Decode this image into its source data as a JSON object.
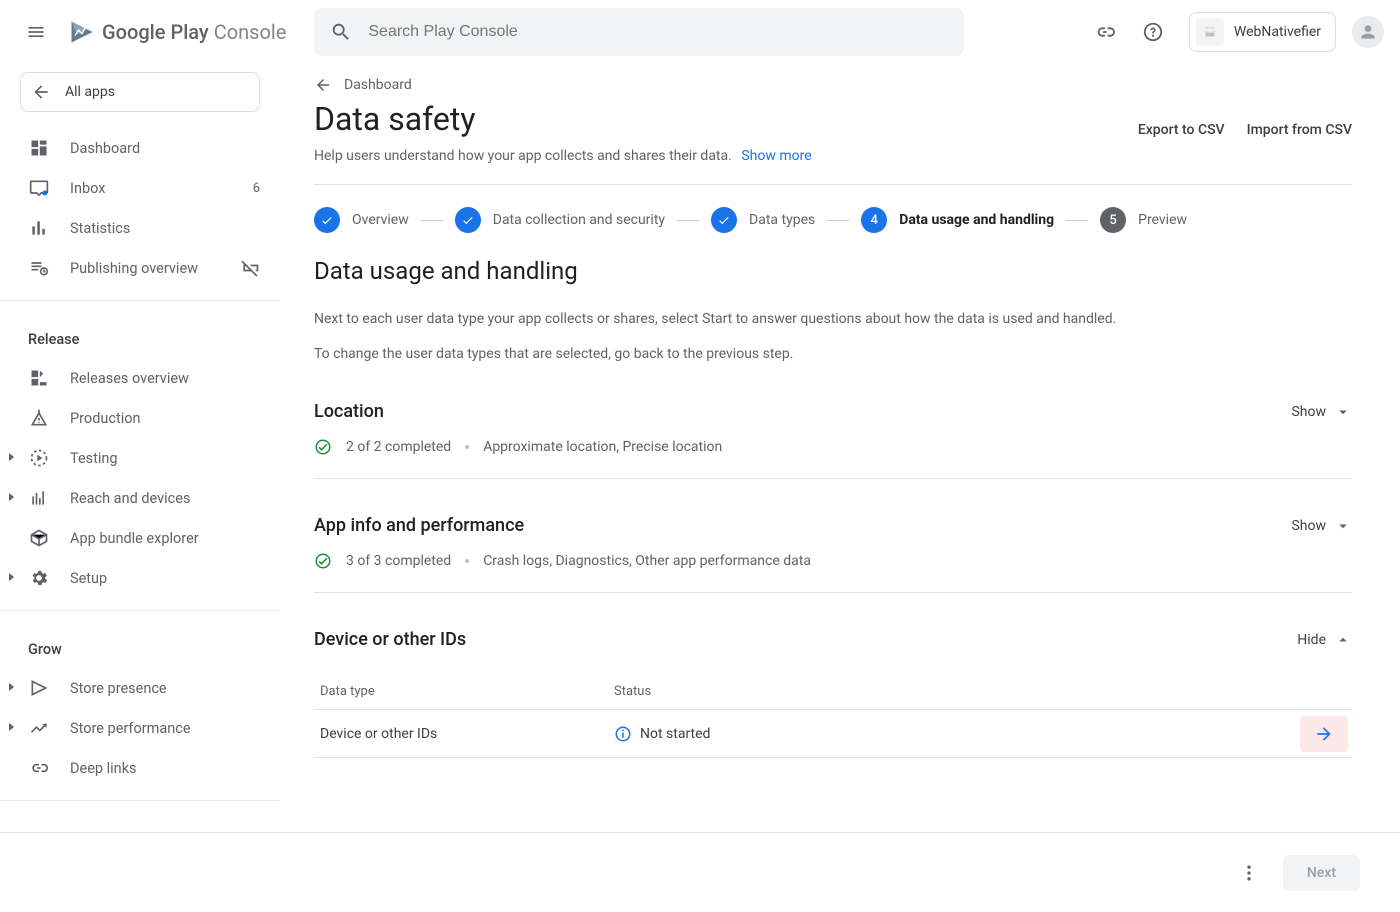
{
  "header": {
    "logo_primary": "Google Play",
    "logo_secondary": "Console",
    "search_placeholder": "Search Play Console",
    "user_chip": "WebNativefier"
  },
  "sidebar": {
    "all_apps": "All apps",
    "items_top": [
      {
        "label": "Dashboard"
      },
      {
        "label": "Inbox",
        "badge": "6"
      },
      {
        "label": "Statistics"
      },
      {
        "label": "Publishing overview"
      }
    ],
    "section_release": "Release",
    "items_release": [
      {
        "label": "Releases overview"
      },
      {
        "label": "Production"
      },
      {
        "label": "Testing",
        "has_caret": true
      },
      {
        "label": "Reach and devices",
        "has_caret": true
      },
      {
        "label": "App bundle explorer"
      },
      {
        "label": "Setup",
        "has_caret": true
      }
    ],
    "section_grow": "Grow",
    "items_grow": [
      {
        "label": "Store presence",
        "has_caret": true
      },
      {
        "label": "Store performance",
        "has_caret": true
      },
      {
        "label": "Deep links"
      }
    ]
  },
  "main": {
    "back_label": "Dashboard",
    "title": "Data safety",
    "subtitle": "Help users understand how your app collects and shares their data.",
    "show_more": "Show more",
    "export_csv": "Export to CSV",
    "import_csv": "Import from CSV",
    "steps": [
      {
        "label": "Overview",
        "state": "done"
      },
      {
        "label": "Data collection and security",
        "state": "done"
      },
      {
        "label": "Data types",
        "state": "done"
      },
      {
        "label": "Data usage and handling",
        "state": "active",
        "num": "4"
      },
      {
        "label": "Preview",
        "state": "pending",
        "num": "5"
      }
    ],
    "section_heading": "Data usage and handling",
    "para1": "Next to each user data type your app collects or shares, select Start to answer questions about how the data is used and handled.",
    "para2": "To change the user data types that are selected, go back to the previous step.",
    "show_label": "Show",
    "hide_label": "Hide",
    "sections": [
      {
        "title": "Location",
        "completed": "2 of 2 completed",
        "detail": "Approximate location, Precise location",
        "expand": "show"
      },
      {
        "title": "App info and performance",
        "completed": "3 of 3 completed",
        "detail": "Crash logs, Diagnostics, Other app performance data",
        "expand": "show"
      },
      {
        "title": "Device or other IDs",
        "expand": "hide",
        "table": {
          "head_type": "Data type",
          "head_status": "Status",
          "row_type": "Device or other IDs",
          "row_status": "Not started"
        }
      }
    ]
  },
  "footer": {
    "next": "Next"
  }
}
